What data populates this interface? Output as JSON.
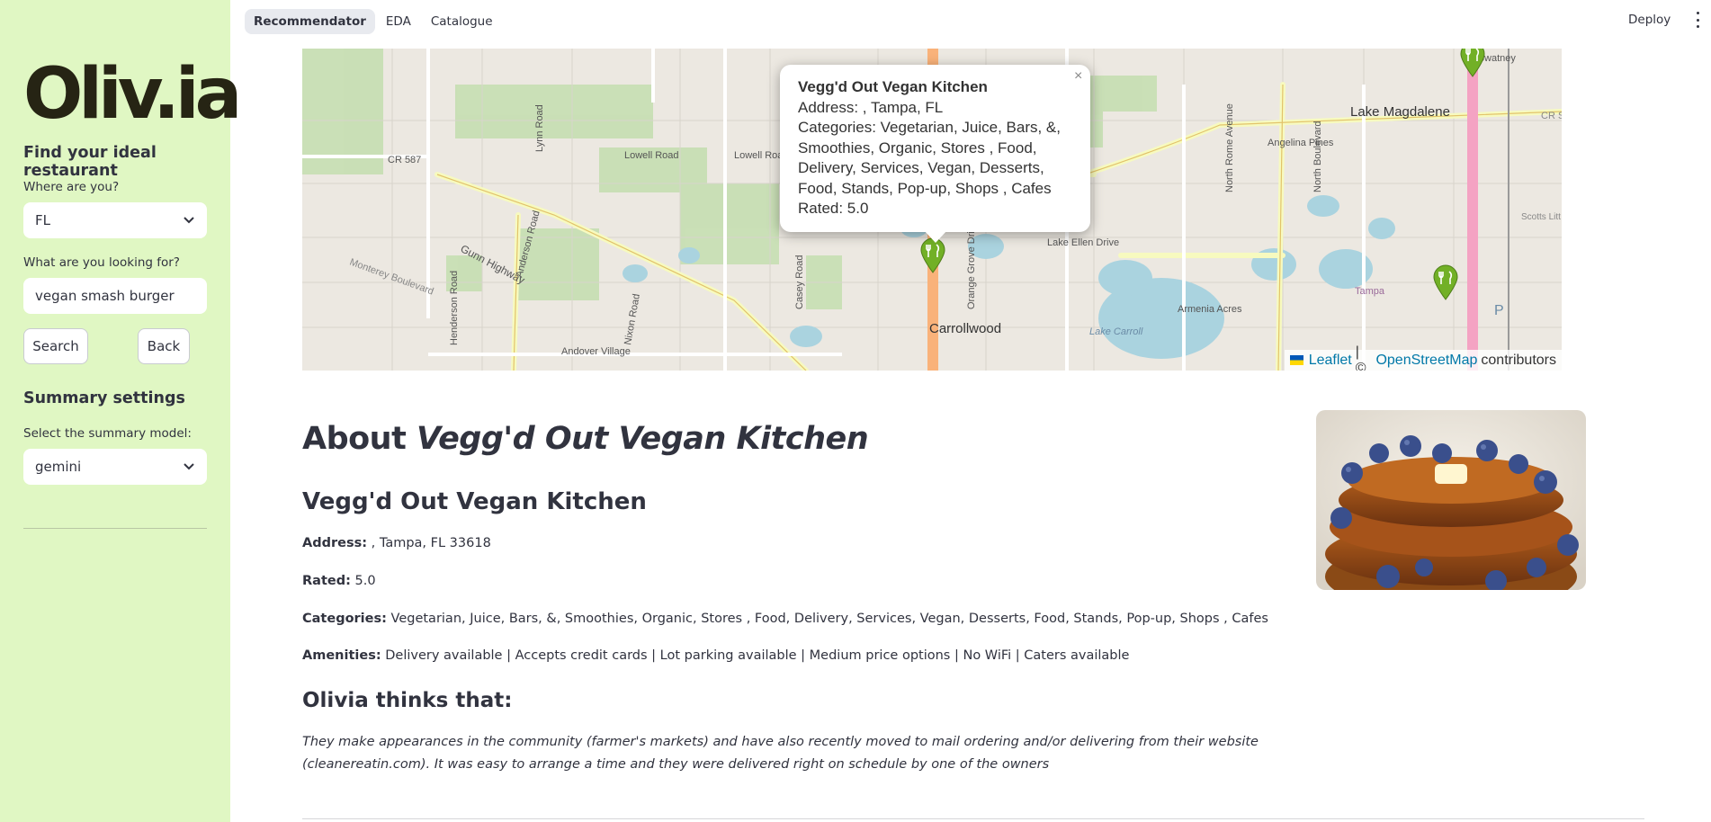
{
  "sidebar": {
    "logo": "Oliv.ia",
    "heading": "Find your ideal restaurant",
    "location_label": "Where are you?",
    "location_value": "FL",
    "query_label": "What are you looking for?",
    "query_value": "vegan smash burger",
    "search_label": "Search",
    "back_label": "Back",
    "summary_heading": "Summary settings",
    "model_label": "Select the summary model:",
    "model_value": "gemini"
  },
  "header": {
    "tabs": [
      {
        "label": "Recommendator",
        "active": true
      },
      {
        "label": "EDA",
        "active": false
      },
      {
        "label": "Catalogue",
        "active": false
      }
    ],
    "deploy_label": "Deploy"
  },
  "map": {
    "popup": {
      "title": "Vegg'd Out Vegan Kitchen",
      "address": "Address: , Tampa, FL",
      "categories": "Categories: Vegetarian, Juice, Bars, &, Smoothies, Organic, Stores , Food, Delivery, Services, Vegan, Desserts, Food, Stands, Pop-up, Shops , Cafes",
      "rated": "Rated: 5.0",
      "close": "×"
    },
    "labels": {
      "lake_magdalene": "Lake Magdalene",
      "nowatney": "Nowatney",
      "angelina_pines": "Angelina Pines",
      "carrollwood": "Carrollwood",
      "armenia_acres": "Armenia Acres",
      "andover_village": "Andover Village",
      "gunn_highway": "Gunn Highway",
      "cr587": "CR 587",
      "lowell_road_1": "Lowell Road",
      "lowell_road_2": "Lowell Road",
      "lynn_road": "Lynn Road",
      "anderson_road": "Anderson Road",
      "henderson_road": "Henderson Road",
      "nixon_road": "Nixon Road",
      "casey_road": "Casey Road",
      "orange_grove": "Orange Grove Drive",
      "lake_ellen": "Lake Ellen Drive",
      "lake_carroll": "Lake Carroll",
      "north_rome": "North Rome Avenue",
      "north_boulevard": "North Boulevard",
      "tampa": "Tampa",
      "scotts": "Scotts Litt Farms",
      "monterey": "Monterey Boulevard",
      "cr_s": "CR S",
      "parking": "P"
    },
    "attribution": {
      "leaflet": "Leaflet",
      "sep": "| ©",
      "osm": "OpenStreetMap",
      "contrib": "contributors"
    },
    "marker_color": "#72b026"
  },
  "main": {
    "about_prefix": "About",
    "about_name": "Vegg'd Out Vegan Kitchen",
    "name": "Vegg'd Out Vegan Kitchen",
    "address_label": "Address:",
    "address_value": " , Tampa, FL 33618",
    "rated_label": "Rated:",
    "rated_value": " 5.0",
    "categories_label": "Categories:",
    "categories_value": " Vegetarian, Juice, Bars, &, Smoothies, Organic, Stores , Food, Delivery, Services, Vegan, Desserts, Food, Stands, Pop-up, Shops , Cafes",
    "amenities_label": "Amenities:",
    "amenities_value": " Delivery available | Accepts credit cards | Lot parking available | Medium price options | No WiFi | Caters available",
    "olivia_heading": "Olivia thinks that:",
    "review": "They make appearances in the community (farmer's markets) and have also recently moved to mail ordering and/or delivering from their website (cleanereatin.com). It was easy to arrange a time and they were delivered right on schedule by one of the owners"
  },
  "colors": {
    "sidebar_bg": "#e0f7c3",
    "link": "#0078a8"
  }
}
